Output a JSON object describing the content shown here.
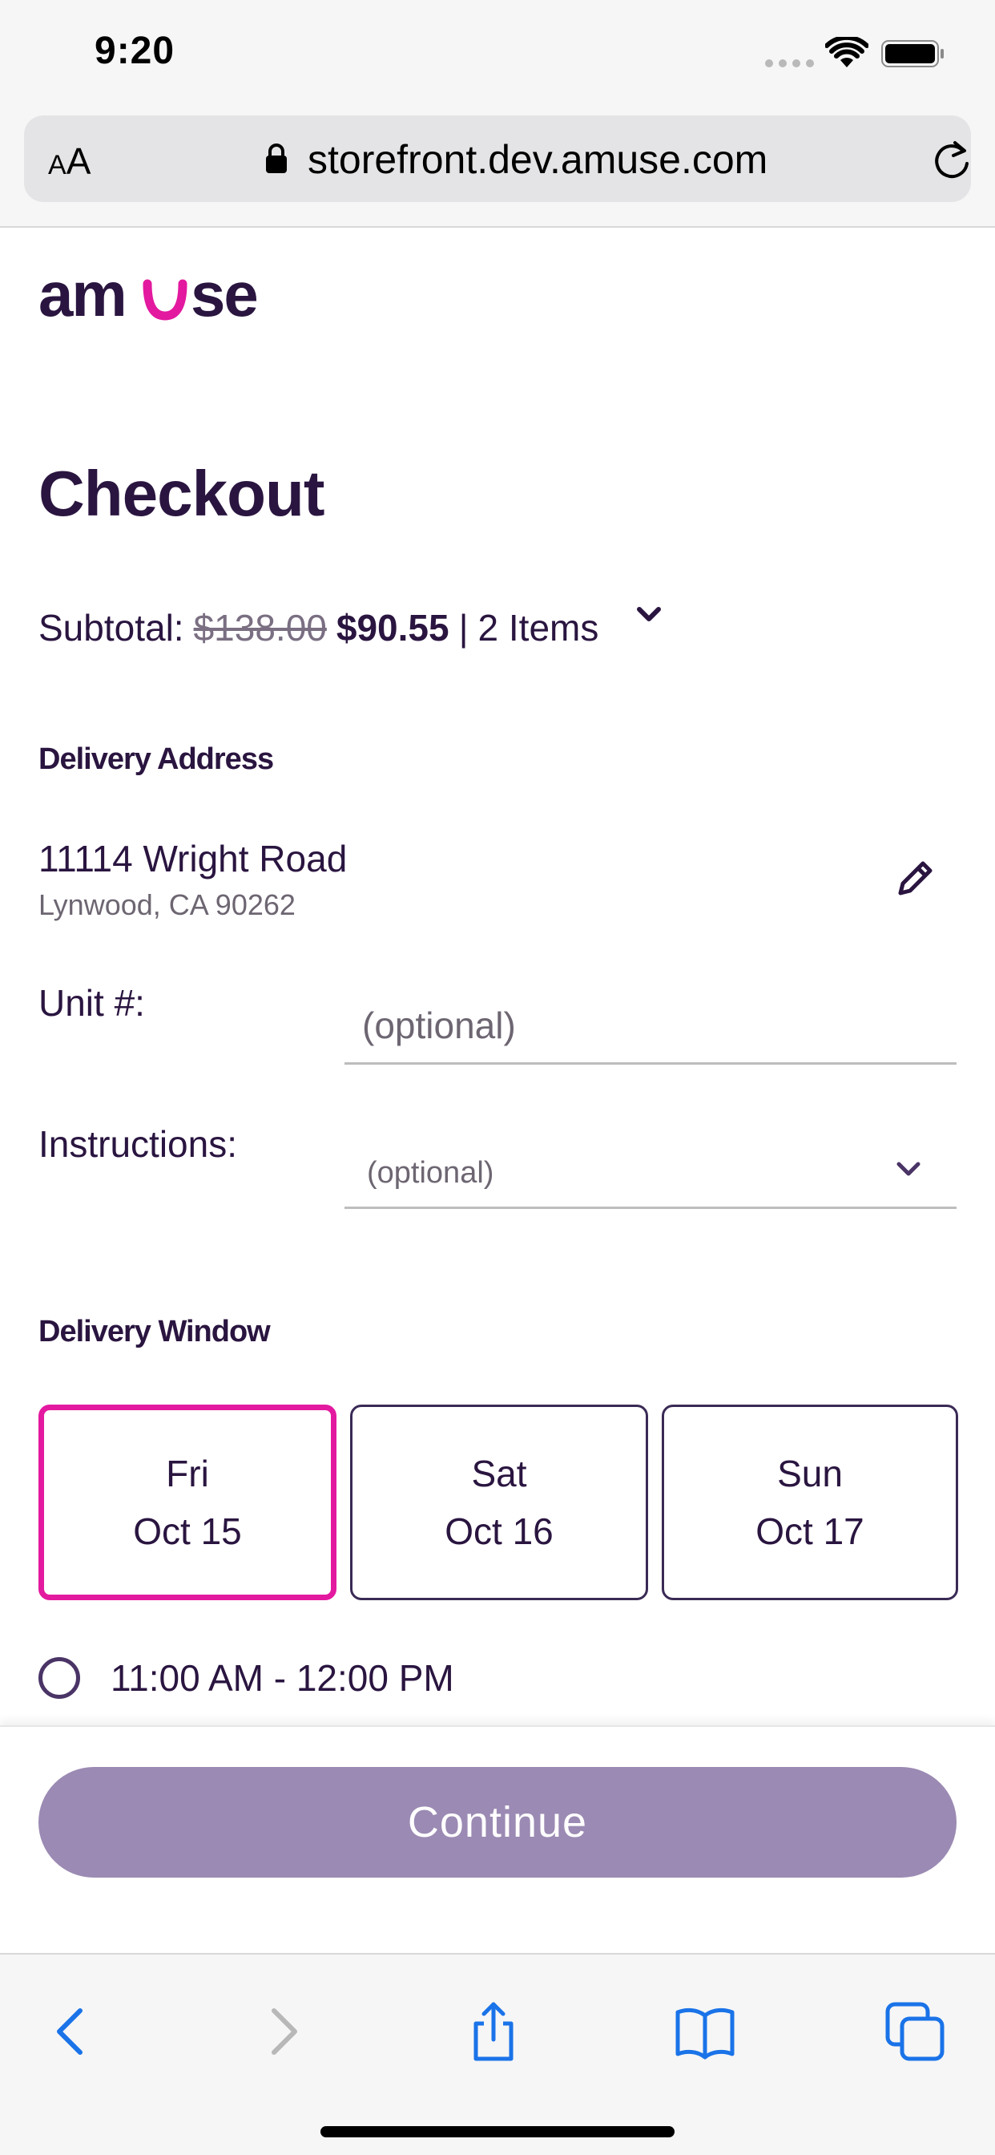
{
  "status_bar": {
    "time": "9:20"
  },
  "browser": {
    "text_size_button": {
      "small": "A",
      "large": "A"
    },
    "url": "storefront.dev.amuse.com",
    "icons": [
      "lock-icon",
      "reload-icon",
      "back-icon",
      "forward-icon",
      "share-icon",
      "bookmarks-icon",
      "tabs-icon"
    ]
  },
  "brand": {
    "logo_text": "amuse",
    "colors": {
      "primary": "#2a1540",
      "accent": "#e3199f",
      "button_disabled": "#9b8ab3",
      "link_blue": "#1a73e8"
    }
  },
  "checkout": {
    "title": "Checkout",
    "subtotal": {
      "label": "Subtotal:",
      "original_price": "$138.00",
      "price": "$90.55",
      "separator": "|",
      "items": "2 Items"
    },
    "delivery_address": {
      "section_label": "Delivery Address",
      "line1": "11114 Wright Road",
      "line2": "Lynwood, CA 90262"
    },
    "unit": {
      "label": "Unit #:",
      "value": "",
      "placeholder": "(optional)"
    },
    "instructions": {
      "label": "Instructions:",
      "selected": "(optional)"
    },
    "delivery_window": {
      "section_label": "Delivery Window",
      "dates": [
        {
          "day": "Fri",
          "date": "Oct 15",
          "selected": true
        },
        {
          "day": "Sat",
          "date": "Oct 16",
          "selected": false
        },
        {
          "day": "Sun",
          "date": "Oct 17",
          "selected": false
        }
      ],
      "times": [
        {
          "label": "11:00 AM - 12:00 PM",
          "selected": false
        }
      ]
    },
    "continue_label": "Continue"
  }
}
